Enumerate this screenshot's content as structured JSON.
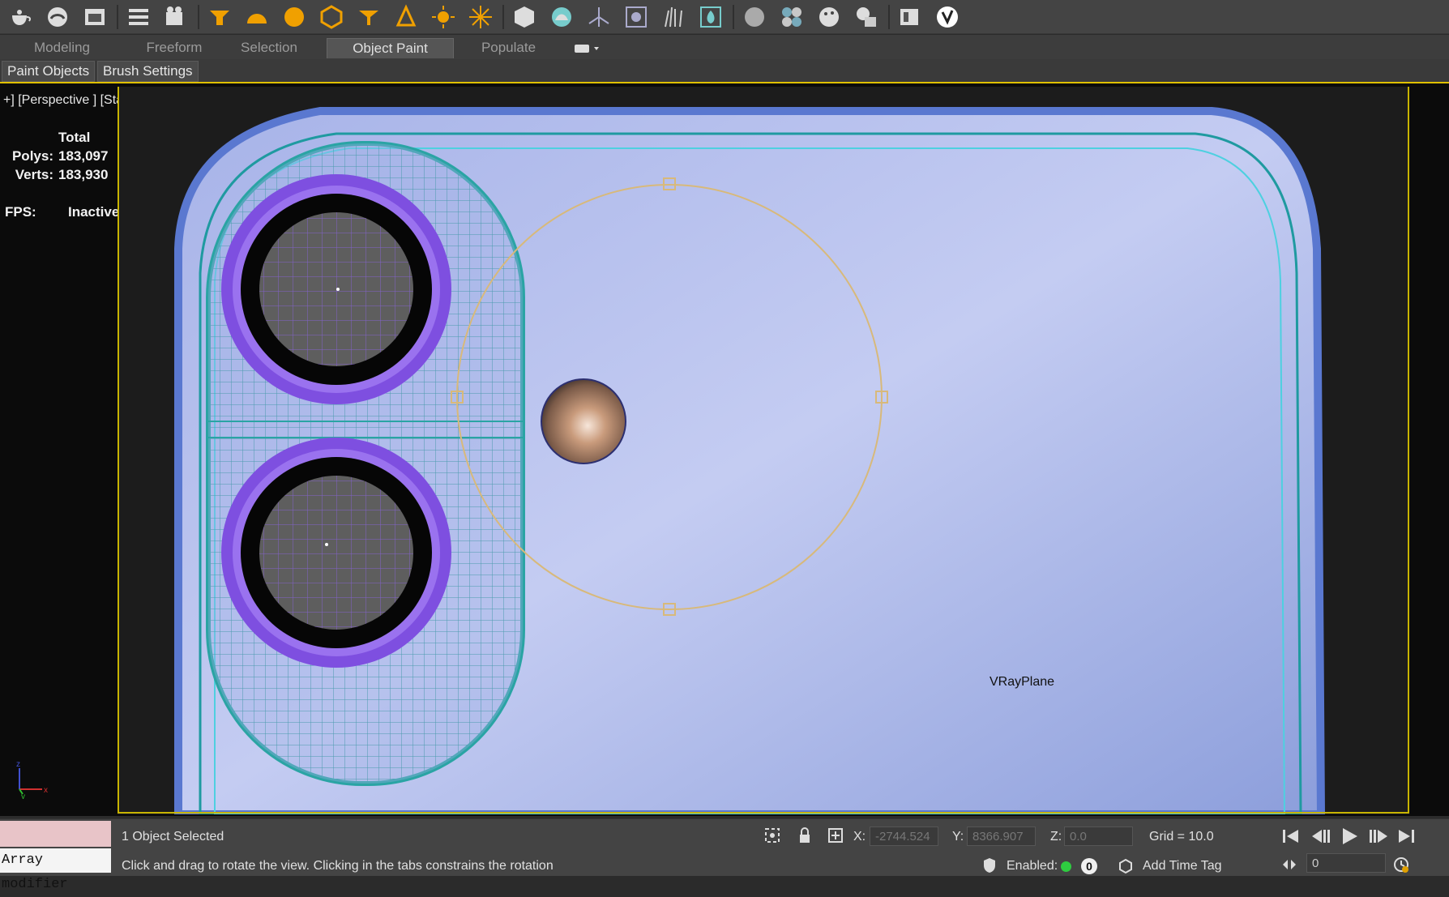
{
  "ribbon": {
    "tabs": [
      {
        "label": "Modeling"
      },
      {
        "label": "Freeform"
      },
      {
        "label": "Selection"
      },
      {
        "label": "Object Paint"
      },
      {
        "label": "Populate"
      }
    ],
    "active_tab": "Object Paint",
    "sub_buttons": [
      {
        "label": "Paint Objects"
      },
      {
        "label": "Brush Settings"
      }
    ]
  },
  "viewport": {
    "label": "+] [Perspective ] [Standard ] [Edged Faces ]",
    "stats": {
      "total_label": "Total",
      "polys_label": "Polys:",
      "polys_value": "183,097",
      "verts_label": "Verts:",
      "verts_value": "183,930",
      "fps_label": "FPS:",
      "fps_value": "Inactive"
    },
    "object_label": "VRayPlane",
    "axis_labels": {
      "z": "z",
      "x": "x",
      "y": "y"
    }
  },
  "status": {
    "script_listener_text": "Array modifier",
    "selection_text": "1 Object Selected",
    "prompt_text": "Click and drag to rotate the view.  Clicking in the tabs constrains the rotation",
    "x_label": "X:",
    "x_value": "-2744.524",
    "y_label": "Y:",
    "y_value": "8366.907",
    "z_label": "Z:",
    "z_value": "0.0",
    "grid_text": "Grid = 10.0",
    "enabled_label": "Enabled:",
    "enabled_count": "0",
    "add_time_tag": "Add Time Tag",
    "frame_value": "0"
  },
  "colors": {
    "accent_yellow": "#e0c000",
    "ribbon_bg": "#3d3d3d",
    "viewport_bg": "#0b0b0b",
    "phone_body": "#8ea0dc",
    "lens_ring": "#8a5ce0",
    "wireframe": "#1e8c8c"
  },
  "icons": [
    "teapot-icon",
    "render-setup-icon",
    "render-frame-icon",
    "layer-manager-icon",
    "camera-icon",
    "spotlight-icon",
    "dome-light-icon",
    "sphere-light-icon",
    "mesh-light-icon",
    "ies-light-icon",
    "omni-light-icon",
    "sun-icon",
    "sky-icon",
    "vray-proxy-icon",
    "vray-fur-icon",
    "vray-plane-icon",
    "vray-sphere-icon",
    "material-icon",
    "multi-material-icon",
    "palette-icon",
    "lightmix-icon",
    "frame-buffer-icon",
    "vray-logo-icon"
  ]
}
